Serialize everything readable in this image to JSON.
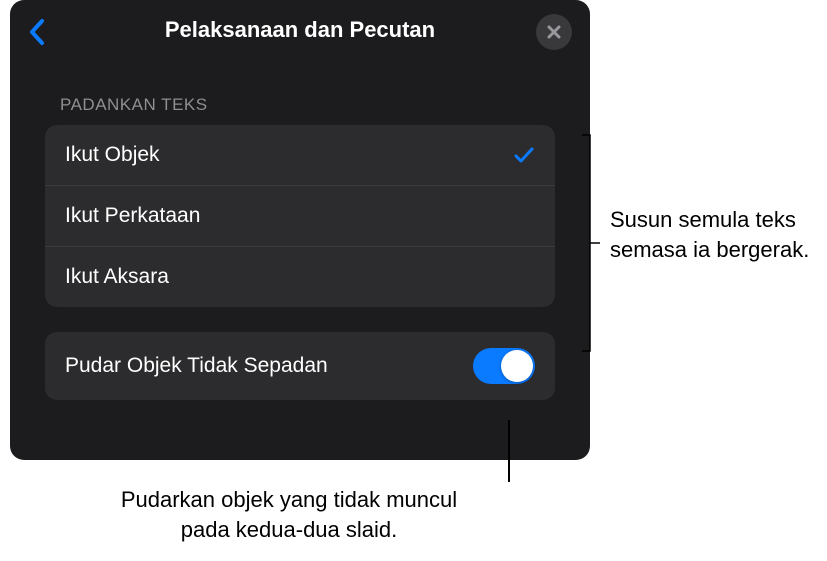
{
  "header": {
    "title": "Pelaksanaan dan Pecutan"
  },
  "section": {
    "label": "PADANKAN TEKS",
    "options": [
      {
        "label": "Ikut Objek",
        "selected": true
      },
      {
        "label": "Ikut Perkataan",
        "selected": false
      },
      {
        "label": "Ikut Aksara",
        "selected": false
      }
    ]
  },
  "toggle": {
    "label": "Pudar Objek Tidak Sepadan",
    "value": true
  },
  "annotations": {
    "right": "Susun semula teks semasa ia bergerak.",
    "bottom": "Pudarkan objek yang tidak muncul pada kedua-dua slaid."
  }
}
